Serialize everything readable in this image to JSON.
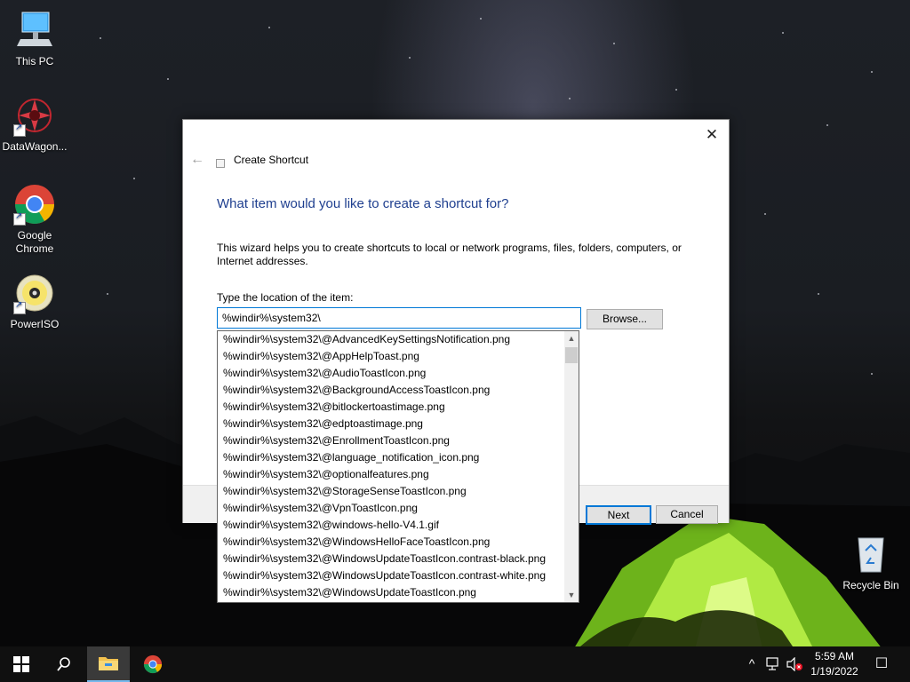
{
  "desktop": {
    "icons": [
      {
        "label": "This PC"
      },
      {
        "label": "DataWagon..."
      },
      {
        "label": "Google\nChrome"
      },
      {
        "label": "PowerISO"
      }
    ],
    "recycle_bin_label": "Recycle Bin"
  },
  "dialog": {
    "title": "Create Shortcut",
    "heading": "What item would you like to create a shortcut for?",
    "description": "This wizard helps you to create shortcuts to local or network programs, files, folders, computers, or Internet addresses.",
    "location_label": "Type the location of the item:",
    "location_value": "%windir%\\system32\\",
    "browse_label": "Browse...",
    "next_label": "Next",
    "cancel_label": "Cancel",
    "close_glyph": "✕",
    "back_glyph": "←"
  },
  "autocomplete": {
    "items": [
      "%windir%\\system32\\@AdvancedKeySettingsNotification.png",
      "%windir%\\system32\\@AppHelpToast.png",
      "%windir%\\system32\\@AudioToastIcon.png",
      "%windir%\\system32\\@BackgroundAccessToastIcon.png",
      "%windir%\\system32\\@bitlockertoastimage.png",
      "%windir%\\system32\\@edptoastimage.png",
      "%windir%\\system32\\@EnrollmentToastIcon.png",
      "%windir%\\system32\\@language_notification_icon.png",
      "%windir%\\system32\\@optionalfeatures.png",
      "%windir%\\system32\\@StorageSenseToastIcon.png",
      "%windir%\\system32\\@VpnToastIcon.png",
      "%windir%\\system32\\@windows-hello-V4.1.gif",
      "%windir%\\system32\\@WindowsHelloFaceToastIcon.png",
      "%windir%\\system32\\@WindowsUpdateToastIcon.contrast-black.png",
      "%windir%\\system32\\@WindowsUpdateToastIcon.contrast-white.png",
      "%windir%\\system32\\@WindowsUpdateToastIcon.png"
    ]
  },
  "taskbar": {
    "time": "5:59 AM",
    "date": "1/19/2022",
    "tray_chevron": "^",
    "notifications_glyph": "☐"
  },
  "colors": {
    "accent": "#0078d7",
    "heading": "#1f3f8f",
    "tent_green": "#9ae02a"
  }
}
